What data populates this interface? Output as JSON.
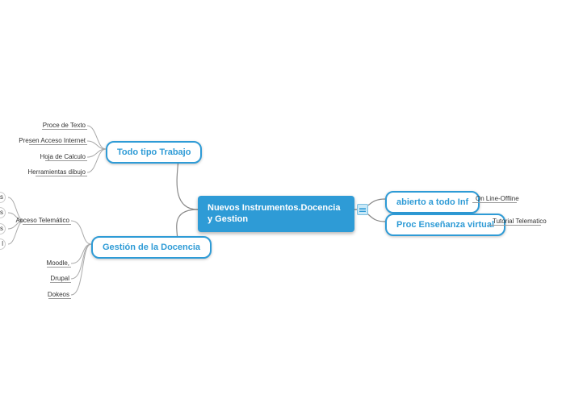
{
  "central": {
    "title": "Nuevos Instrumentos.Docencia y Gestion"
  },
  "branches": {
    "todo_tipo": {
      "label": "Todo tipo Trabajo",
      "leaves": [
        "Proce de Texto",
        "Presen Acceso Internet",
        "Hoja de Calculo",
        "Herramientas dibujo"
      ]
    },
    "gestion": {
      "label": "Gestión de la Docencia",
      "leaves_top": [
        "Acceso Telemático"
      ],
      "leaves_bottom": [
        "Moodle,",
        "Drupal",
        "Dokeos"
      ]
    },
    "abierto": {
      "label": "abierto a todo Inf",
      "leaves": [
        "On Line-Offline"
      ]
    },
    "proc": {
      "label": "Proc Enseñanza virtual",
      "leaves": [
        "Tutorial Telematico"
      ]
    }
  },
  "cut_labels": [
    "s",
    "s",
    "s",
    "l"
  ]
}
